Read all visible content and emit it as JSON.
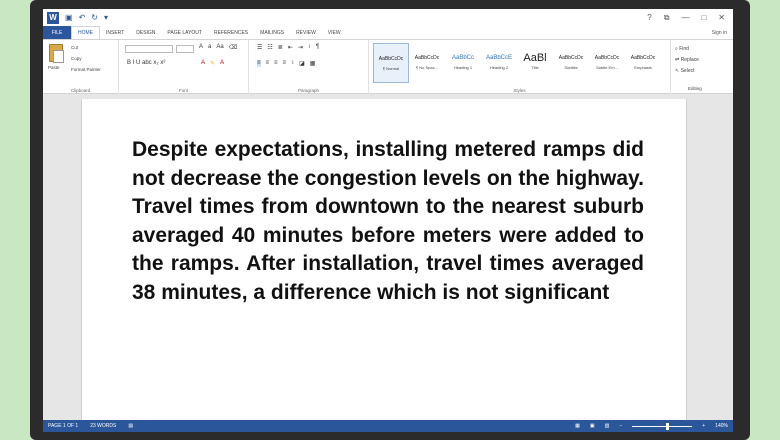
{
  "titlebar": {
    "app_icon": "W",
    "help": "?",
    "restore": "⧉",
    "minimize": "—",
    "maximize": "□",
    "close": "✕"
  },
  "tabs": {
    "file": "FILE",
    "items": [
      "HOME",
      "INSERT",
      "DESIGN",
      "PAGE LAYOUT",
      "REFERENCES",
      "MAILINGS",
      "REVIEW",
      "VIEW"
    ],
    "signin": "Sign in"
  },
  "ribbon": {
    "clipboard": {
      "paste": "Paste",
      "cut": "Cut",
      "copy": "Copy",
      "format_painter": "Format Painter",
      "label": "Clipboard"
    },
    "font": {
      "label": "Font",
      "buttons": "B  I  U  abc  x₂  x²"
    },
    "paragraph": {
      "label": "Paragraph"
    },
    "styles": {
      "label": "Styles",
      "items": [
        {
          "sample": "AaBbCcDc",
          "name": "¶ Normal"
        },
        {
          "sample": "AaBbCcDc",
          "name": "¶ No Spac..."
        },
        {
          "sample": "AaBbCc",
          "name": "Heading 1"
        },
        {
          "sample": "AaBbCcE",
          "name": "Heading 2"
        },
        {
          "sample": "AaBl",
          "name": "Title"
        },
        {
          "sample": "AaBbCcDc",
          "name": "Subtitle"
        },
        {
          "sample": "AaBbCcDc",
          "name": "Subtle Em..."
        },
        {
          "sample": "AaBbCcDc",
          "name": "Emphasis"
        }
      ]
    },
    "editing": {
      "find": "Find",
      "replace": "Replace",
      "select": "Select",
      "label": "Editing"
    }
  },
  "document": {
    "text": "Despite expectations, installing metered ramps did not decrease the congestion levels on the highway. Travel times from downtown to the nearest suburb averaged 40 minutes before meters were added to the ramps. After installation, travel times averaged 38 minutes, a difference which is not significant"
  },
  "status": {
    "page": "PAGE 1 OF 1",
    "words": "23 WORDS",
    "zoom": "140%"
  }
}
